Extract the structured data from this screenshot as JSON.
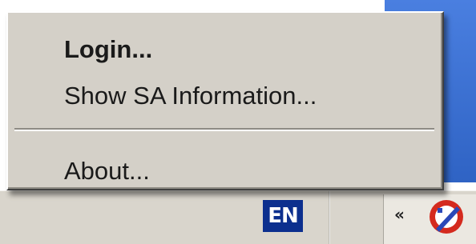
{
  "context_menu": {
    "items": [
      {
        "label": "Login...",
        "default": true
      },
      {
        "label": "Show SA Information...",
        "default": false
      },
      {
        "label": "About...",
        "default": false
      }
    ]
  },
  "taskbar": {
    "language_indicator": "EN",
    "tray_chevron": "«",
    "tray_icon": "vpn-client-icon"
  },
  "colors": {
    "menu_background": "#d4d0c8",
    "desktop_blue": "#3a6fd0",
    "language_badge": "#0c2f8e",
    "tray_icon_red": "#d42a1e"
  }
}
